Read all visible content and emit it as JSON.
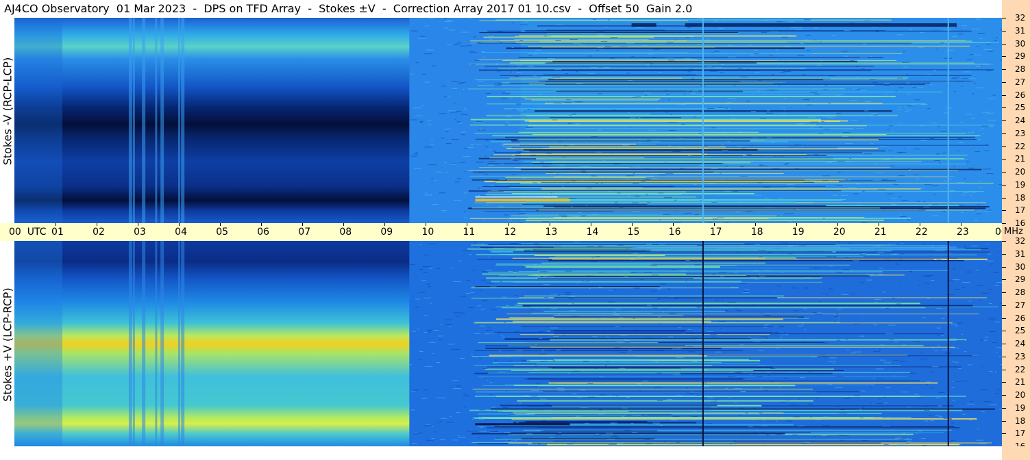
{
  "title": "AJ4CO Observatory  01 Mar 2023  -  DPS on TFD Array  -  Stokes ±V  -  Correction Array 2017 01 10.csv  -  Offset 50  Gain 2.0",
  "panels": {
    "top": {
      "ylabel": "Stokes -V (RCP-LCP)"
    },
    "bottom": {
      "ylabel": "Stokes +V (LCP-RCP)"
    }
  },
  "time_axis": {
    "start_label": "00  UTC",
    "end_label": "00",
    "unit": "MHz",
    "hour_labels": [
      "01",
      "02",
      "03",
      "04",
      "05",
      "06",
      "07",
      "08",
      "09",
      "10",
      "11",
      "12",
      "13",
      "14",
      "15",
      "16",
      "17",
      "18",
      "19",
      "20",
      "21",
      "22",
      "23"
    ]
  },
  "chart_data": {
    "type": "heatmap",
    "x_axis": {
      "label": "UTC",
      "range": [
        0,
        24
      ]
    },
    "y_axis": {
      "unit": "MHz",
      "range": [
        16,
        32
      ],
      "ticks": [
        16,
        17,
        18,
        19,
        20,
        21,
        22,
        23,
        24,
        25,
        26,
        27,
        28,
        29,
        30,
        31,
        32
      ]
    },
    "colors": {
      "background": "#1f7fe6",
      "dark": "#04123f",
      "hot": "#f2c21a",
      "mid": "#7ce3a2"
    },
    "series": [
      {
        "panel": "top",
        "quantity": "Stokes -V (RCP-LCP)"
      },
      {
        "panel": "bottom",
        "quantity": "Stokes +V (LCP-RCP)"
      }
    ]
  }
}
